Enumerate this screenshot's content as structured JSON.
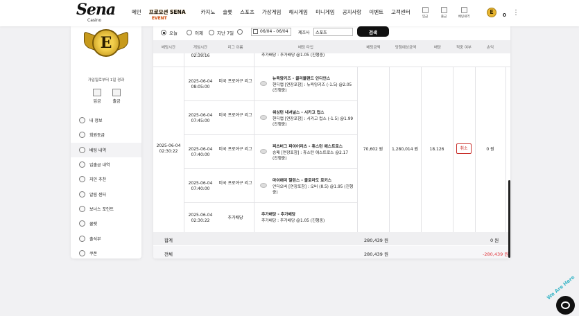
{
  "header": {
    "brand": "Sena",
    "brand_sub": "Casino",
    "nav": [
      "메인",
      "카지노",
      "슬롯",
      "스포츠",
      "가상게임",
      "해시게임",
      "미니게임",
      "공지사항",
      "이벤트",
      "고객센터"
    ],
    "promo": "프로모션 SENA",
    "promo_sub": "EVENT",
    "icons": [
      {
        "label": "입금",
        "icon": "deposit-icon"
      },
      {
        "label": "출금",
        "icon": "withdraw-icon"
      },
      {
        "label": "베팅내역",
        "icon": "bet-history-icon"
      }
    ],
    "coin_letter": "E",
    "balance": "0"
  },
  "sidebar": {
    "emblem_letter": "E",
    "note": "가입일로부터 1일 경과",
    "quick": [
      {
        "label": "입금",
        "icon": "deposit-icon"
      },
      {
        "label": "출금",
        "icon": "withdraw-icon"
      }
    ],
    "items": [
      {
        "label": "내 정보",
        "active": false
      },
      {
        "label": "회원등급",
        "active": false
      },
      {
        "label": "베팅 내역",
        "active": true
      },
      {
        "label": "입출금 내역",
        "active": false
      },
      {
        "label": "지인 추천",
        "active": false
      },
      {
        "label": "알림 센터",
        "active": false
      },
      {
        "label": "보너스 포인트",
        "active": false
      },
      {
        "label": "쿨렛",
        "active": false
      },
      {
        "label": "출석부",
        "active": false
      },
      {
        "label": "쿠폰",
        "active": false
      }
    ]
  },
  "filter": {
    "radios": [
      "오늘",
      "어제",
      "지난 7일"
    ],
    "selected": "오늘",
    "date_range": "06/04 - 06/04",
    "title_label": "제조사",
    "search_value": "스포츠",
    "search_button": "검색"
  },
  "table": {
    "headers": [
      "베팅시간",
      "게임시간",
      "리그 이름",
      "베팅 타입",
      "베팅금액",
      "당첨예상금액",
      "배당",
      "적중 여부",
      "손익"
    ],
    "top_partial": {
      "game_time": "02:39:16",
      "league": "??·?6",
      "bet": "추가배당 : 추가배당 @1.05 (진행중)"
    },
    "group": {
      "bet_time": "2025-06-04 02:30:22",
      "amount": "70,602 원",
      "expected": "1,280,014 원",
      "odds": "18.126",
      "status": "취소",
      "profit": "0 원"
    },
    "rows": [
      {
        "game_time": "2025-06-04 08:05:00",
        "league": "미국 프로야구 리그",
        "title": "뉴욕양키즈 - 클리블랜드 인디언스",
        "detail": "핸디캡 [연장포함] : 뉴욕양키즈 (-1.5) @2.05 (진행중)"
      },
      {
        "game_time": "2025-06-04 07:45:00",
        "league": "미국 프로야구 리그",
        "title": "워싱턴 내셔널스 - 시카고 컵스",
        "detail": "핸디캡 [연장포함] : 시카고 컵스 (-1.5) @1.99 (진행중)"
      },
      {
        "game_time": "2025-06-04 07:40:00",
        "league": "미국 프로야구 리그",
        "title": "피츠버그 파이어리츠 - 휴스턴 애스트로스",
        "detail": "승패 [연장포함] : 휴스턴 애스트로스 @2.17 (진행중)"
      },
      {
        "game_time": "2025-06-04 07:40:00",
        "league": "미국 프로야구 리그",
        "title": "마이애미 말린스 - 콜로라도 로키스",
        "detail": "언더오버 [연장포함] : 오버 (8.5) @1.95 (진행중)"
      },
      {
        "game_time": "2025-06-04 02:30:22",
        "league": "추가배당",
        "title": "추가배당 - 추가배당",
        "detail": "추가배당 : 추가배당 @1.05 (진행중)"
      }
    ],
    "subtotal": {
      "label": "합계",
      "amount": "280,439 원",
      "profit": "0 원"
    },
    "total": {
      "label": "전체",
      "amount": "280,439 원",
      "profit": "-280,439 원"
    },
    "loss_color": "#e0383e"
  },
  "chat_label": "We Are Here"
}
